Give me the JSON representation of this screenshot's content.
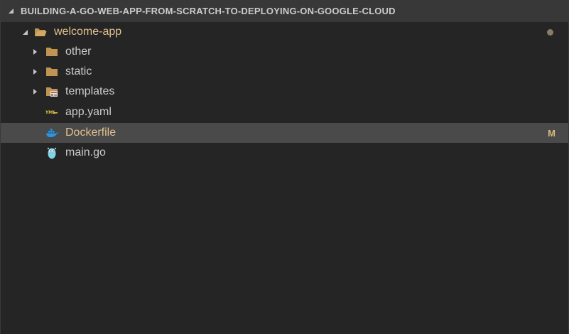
{
  "explorer": {
    "section_title": "BUILDING-A-GO-WEB-APP-FROM-SCRATCH-TO-DEPLOYING-ON-GOOGLE-CLOUD",
    "root_folder": {
      "label": "welcome-app",
      "icon": "folder-open-icon",
      "has_changes_dot": true
    },
    "items": [
      {
        "label": "other",
        "type": "folder",
        "icon": "folder-icon"
      },
      {
        "label": "static",
        "type": "folder",
        "icon": "folder-icon"
      },
      {
        "label": "templates",
        "type": "folder",
        "icon": "folder-templates-icon"
      },
      {
        "label": "app.yaml",
        "type": "file",
        "icon": "yaml-icon"
      },
      {
        "label": "Dockerfile",
        "type": "file",
        "icon": "docker-icon",
        "status": "M",
        "selected": true
      },
      {
        "label": "main.go",
        "type": "file",
        "icon": "go-gopher-icon"
      }
    ]
  },
  "colors": {
    "background": "#252526",
    "header_background": "#383838",
    "selected_background": "#4a4a4a",
    "text": "#cccccc",
    "modified_text": "#e2c08d",
    "folder": "#c09553",
    "docker": "#2496ed",
    "go": "#7fd5ea"
  }
}
